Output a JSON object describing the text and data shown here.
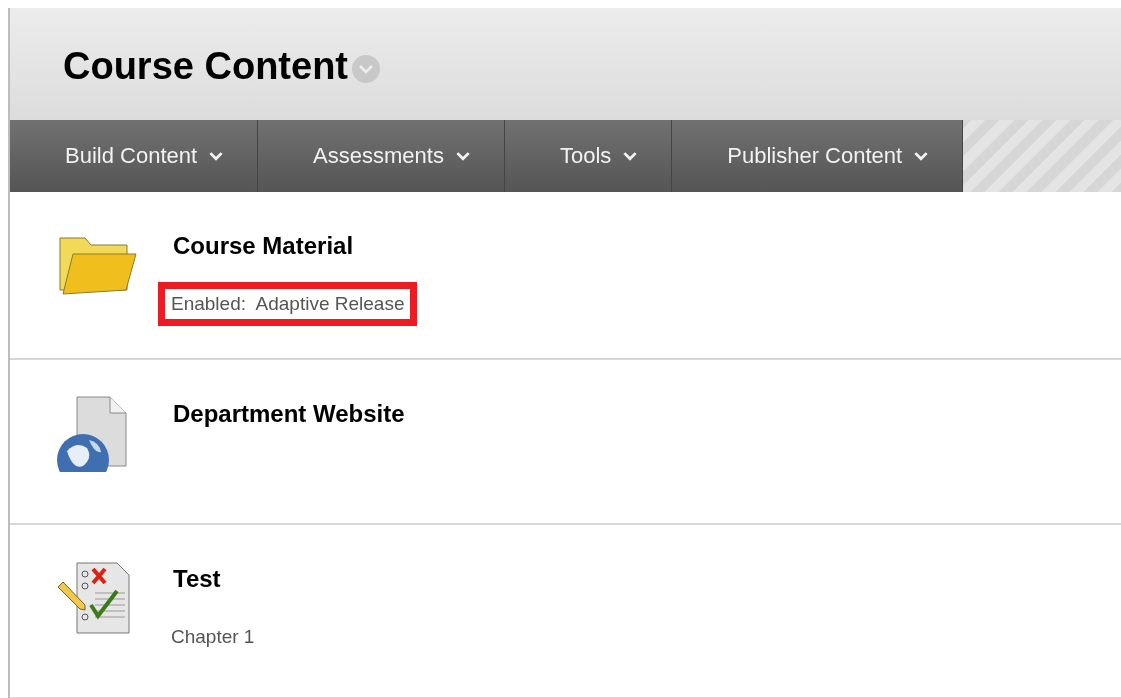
{
  "page": {
    "title": "Course Content"
  },
  "menu": [
    {
      "label": "Build Content"
    },
    {
      "label": "Assessments"
    },
    {
      "label": "Tools"
    },
    {
      "label": "Publisher Content"
    }
  ],
  "items": [
    {
      "kind": "folder",
      "title": "Course Material",
      "detail": "Enabled:  Adaptive Release",
      "highlighted": true
    },
    {
      "kind": "link",
      "title": "Department Website"
    },
    {
      "kind": "test",
      "title": "Test",
      "detail": "Chapter 1",
      "highlighted": false
    }
  ]
}
